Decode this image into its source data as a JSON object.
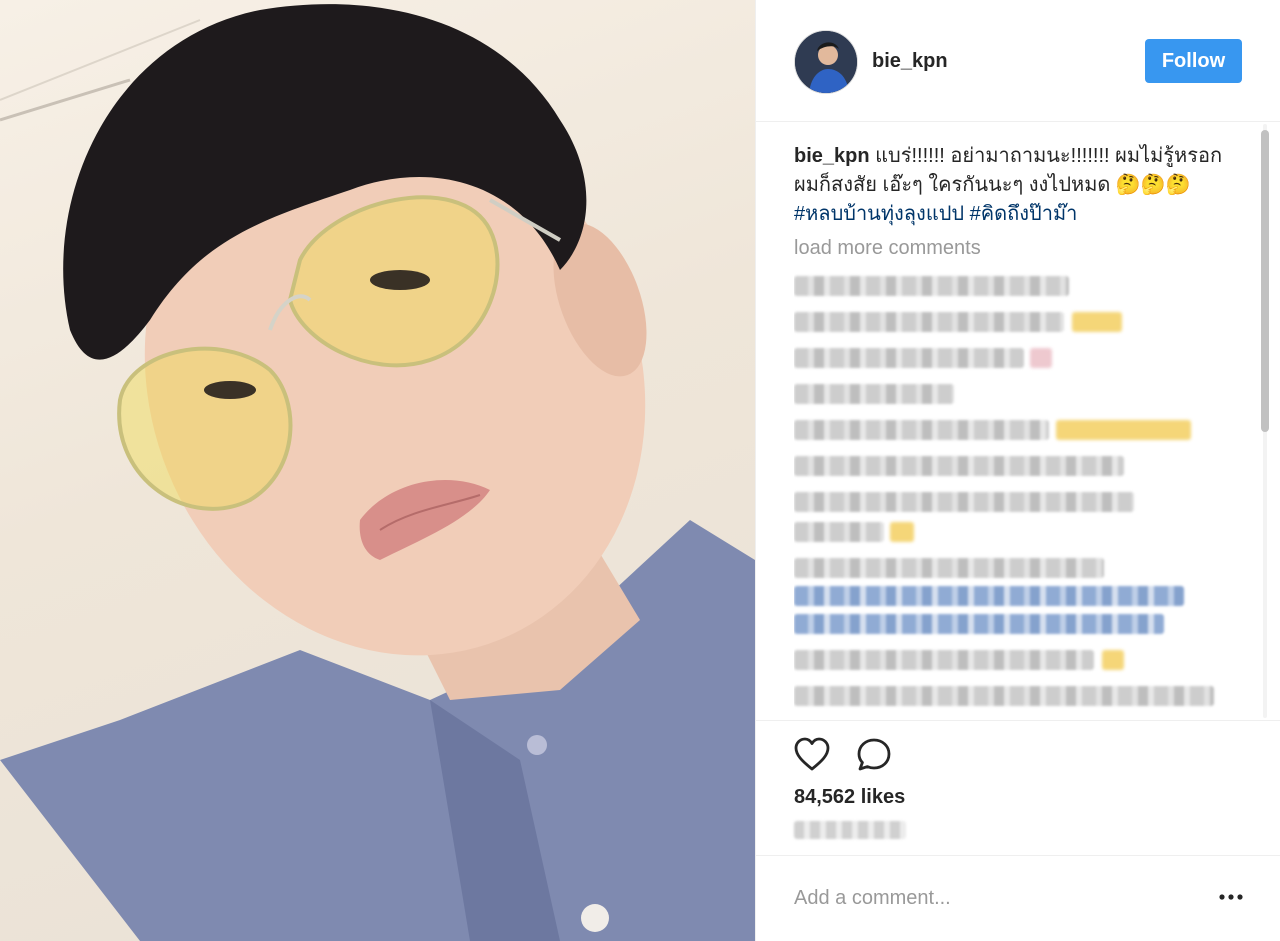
{
  "post": {
    "username": "bie_kpn",
    "follow_label": "Follow",
    "caption": {
      "user": "bie_kpn",
      "text": "แบร่!!!!!! อย่ามาถามนะ!!!!!!! ผมไม่รู้หรอก ผมก็สงสัย เอ๊ะๆ ใครกันนะๆ งงไปหมด 🤔🤔🤔",
      "hashtags": [
        "#หลบบ้านทุ่งลุงแปป",
        "#คิดถึงป๊าม๊า"
      ]
    },
    "load_more_label": "load more comments",
    "likes_label": "84,562 likes",
    "add_comment_placeholder": "Add a comment...",
    "more_options_icon": "ellipsis-icon"
  },
  "icons": {
    "like": "heart-outline-icon",
    "comment": "speech-bubble-icon"
  },
  "colors": {
    "follow_button": "#3897f0",
    "hashtag": "#003569",
    "muted_text": "#999999",
    "border": "#efefef"
  }
}
